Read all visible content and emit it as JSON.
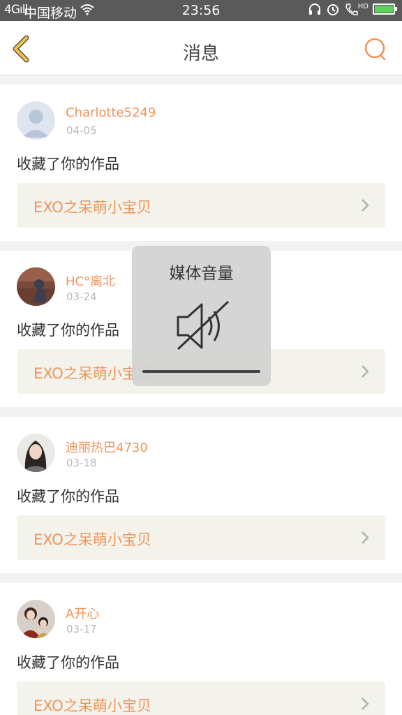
{
  "status": {
    "signal": "4G",
    "carrier": "中国移动",
    "time": "23:56",
    "hd": "HD"
  },
  "header": {
    "title": "消息"
  },
  "messages": [
    {
      "user": "Charlotte5249",
      "date": "04-05",
      "action": "收藏了你的作品",
      "work": "EXO之呆萌小宝贝"
    },
    {
      "user": "HC°离北",
      "date": "03-24",
      "action": "收藏了你的作品",
      "work": "EXO之呆萌小宝贝"
    },
    {
      "user": "迪丽热巴4730",
      "date": "03-18",
      "action": "收藏了你的作品",
      "work": "EXO之呆萌小宝贝"
    },
    {
      "user": "A开心",
      "date": "03-17",
      "action": "收藏了你的作品",
      "work": "EXO之呆萌小宝贝"
    }
  ],
  "volume_toast": {
    "title": "媒体音量",
    "level": 0
  },
  "colors": {
    "accent": "#f0945a",
    "back_arrow": "#f5c542",
    "status_bar": "#5a5a5a"
  }
}
